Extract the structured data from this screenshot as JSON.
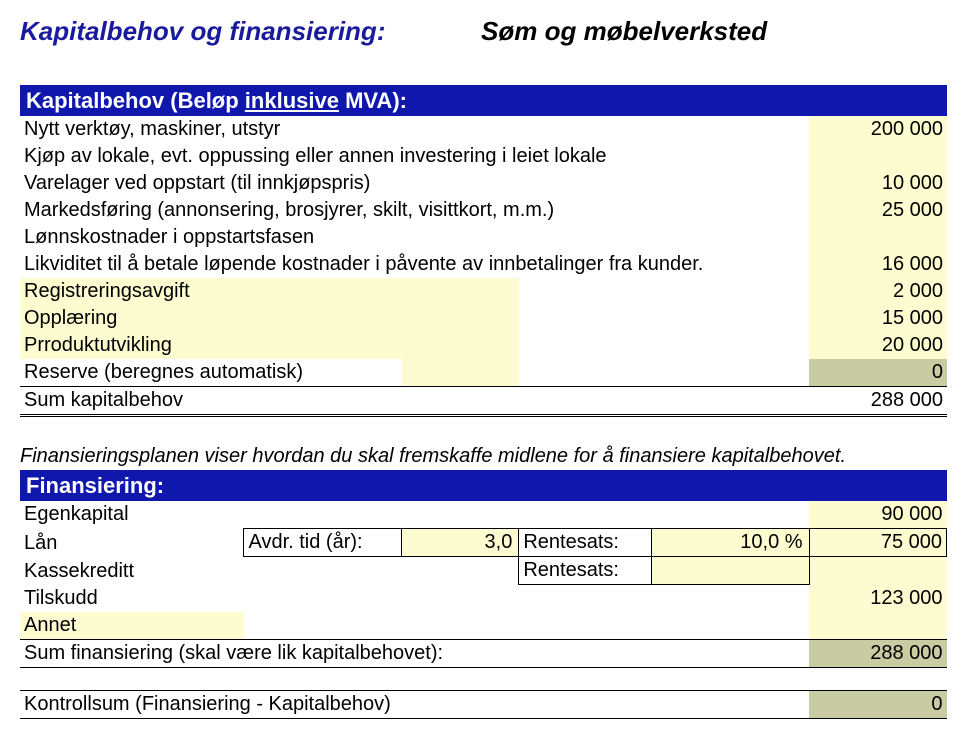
{
  "title_left": "Kapitalbehov og finansiering:",
  "title_right": "Søm og møbelverksted",
  "cap_header_a": "Kapitalbehov (Beløp ",
  "cap_header_u": "inklusive",
  "cap_header_b": " MVA):",
  "cap": {
    "r1": {
      "l": "Nytt verktøy, maskiner, utstyr",
      "v": "200 000"
    },
    "r2": {
      "l": "Kjøp av lokale, evt. oppussing eller annen investering i leiet lokale",
      "v": ""
    },
    "r3": {
      "l": "Varelager ved oppstart (til innkjøpspris)",
      "v": "10 000"
    },
    "r4": {
      "l": "Markedsføring (annonsering, brosjyrer, skilt, visittkort, m.m.)",
      "v": "25 000"
    },
    "r5": {
      "l": "Lønnskostnader i oppstartsfasen",
      "v": ""
    },
    "r6": {
      "l": "Likviditet til å betale løpende kostnader i påvente av innbetalinger fra kunder.",
      "v": "16 000"
    },
    "r7": {
      "l": "Registreringsavgift",
      "v": "2 000"
    },
    "r8": {
      "l": "Opplæring",
      "v": "15 000"
    },
    "r9": {
      "l": "Prroduktutvikling",
      "v": "20 000"
    },
    "r10": {
      "l": "Reserve (beregnes automatisk)",
      "v": "0"
    },
    "sum_l": "Sum kapitalbehov",
    "sum_v": "288 000"
  },
  "intro": "Finansieringsplanen viser hvordan du skal fremskaffe midlene for å finansiere kapitalbehovet.",
  "fin_header": "Finansiering:",
  "fin": {
    "egen_l": "Egenkapital",
    "egen_v": "90 000",
    "loan_l": "Lån",
    "avdr_l": "Avdr. tid (år):",
    "avdr_v": "3,0",
    "rente_l": "Rentesats:",
    "rente_v": "10,0 %",
    "loan_v": "75 000",
    "kasse_l": "Kassekreditt",
    "kasse_rente_l": "Rentesats:",
    "kasse_rente_v": "",
    "tilskudd_l": "Tilskudd",
    "tilskudd_v": "123 000",
    "annet_l": "Annet",
    "annet_v": "",
    "sum_l": "Sum finansiering (skal være lik kapitalbehovet):",
    "sum_v": "288 000",
    "kontroll_l": "Kontrollsum (Finansiering - Kapitalbehov)",
    "kontroll_v": "0"
  }
}
